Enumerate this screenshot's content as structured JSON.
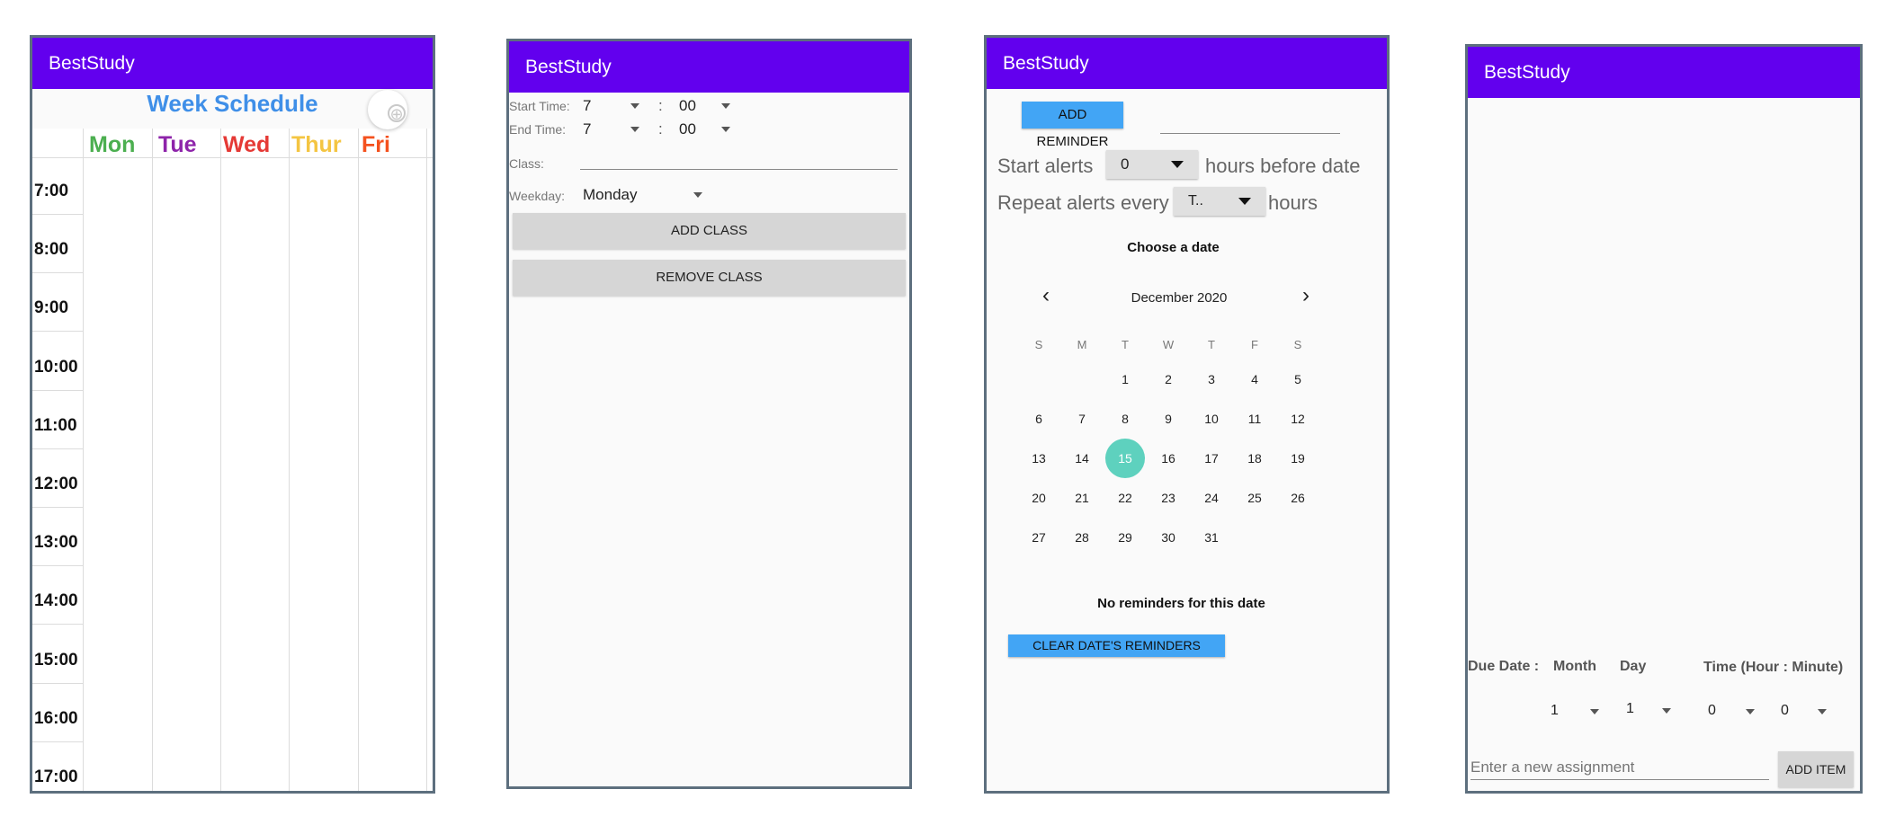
{
  "app_name": "BestStudy",
  "schedule": {
    "title": "Week Schedule",
    "days": [
      {
        "label": "Mon",
        "color": "#4caf50"
      },
      {
        "label": "Tue",
        "color": "#8e24aa"
      },
      {
        "label": "Wed",
        "color": "#e53935"
      },
      {
        "label": "Thur",
        "color": "#f4c542"
      },
      {
        "label": "Fri",
        "color": "#f4511e"
      }
    ],
    "hours": [
      "7:00",
      "8:00",
      "9:00",
      "10:00",
      "11:00",
      "12:00",
      "13:00",
      "14:00",
      "15:00",
      "16:00",
      "17:00"
    ],
    "fab_icon": "settings-target-icon"
  },
  "class_form": {
    "start_label": "Start Time:",
    "end_label": "End Time:",
    "start_hour": "7",
    "start_min": "00",
    "end_hour": "7",
    "end_min": "00",
    "separator": ":",
    "class_label": "Class:",
    "class_value": "",
    "weekday_label": "Weekday:",
    "weekday_value": "Monday",
    "add_button": "ADD CLASS",
    "remove_button": "REMOVE CLASS"
  },
  "reminders": {
    "add_button": "ADD REMINDER",
    "reminder_input": "",
    "start_alerts_prefix": "Start alerts",
    "start_alerts_value": "0",
    "start_alerts_suffix": "hours before date",
    "repeat_prefix": "Repeat alerts every",
    "repeat_value": "T..",
    "repeat_suffix": "hours",
    "choose_date": "Choose a date",
    "month_label": "December 2020",
    "prev_icon": "chevron-left-icon",
    "next_icon": "chevron-right-icon",
    "weekdays": [
      "S",
      "M",
      "T",
      "W",
      "T",
      "F",
      "S"
    ],
    "first_weekday_index": 2,
    "days_in_month": 31,
    "selected_day": 15,
    "empty_text": "No reminders for this date",
    "clear_button": "CLEAR DATE'S REMINDERS",
    "accent": "#42a5f5",
    "selected_color": "#5ed1be"
  },
  "assignments": {
    "due_label": "Due Date :",
    "month_label": "Month",
    "day_label": "Day",
    "time_label": "Time (Hour : Minute)",
    "month_value": "1",
    "day_value": "1",
    "hour_value": "0",
    "minute_value": "0",
    "input_placeholder": "Enter a new assignment",
    "add_button": "ADD ITEM"
  },
  "colors": {
    "appbar": "#6200ee"
  }
}
